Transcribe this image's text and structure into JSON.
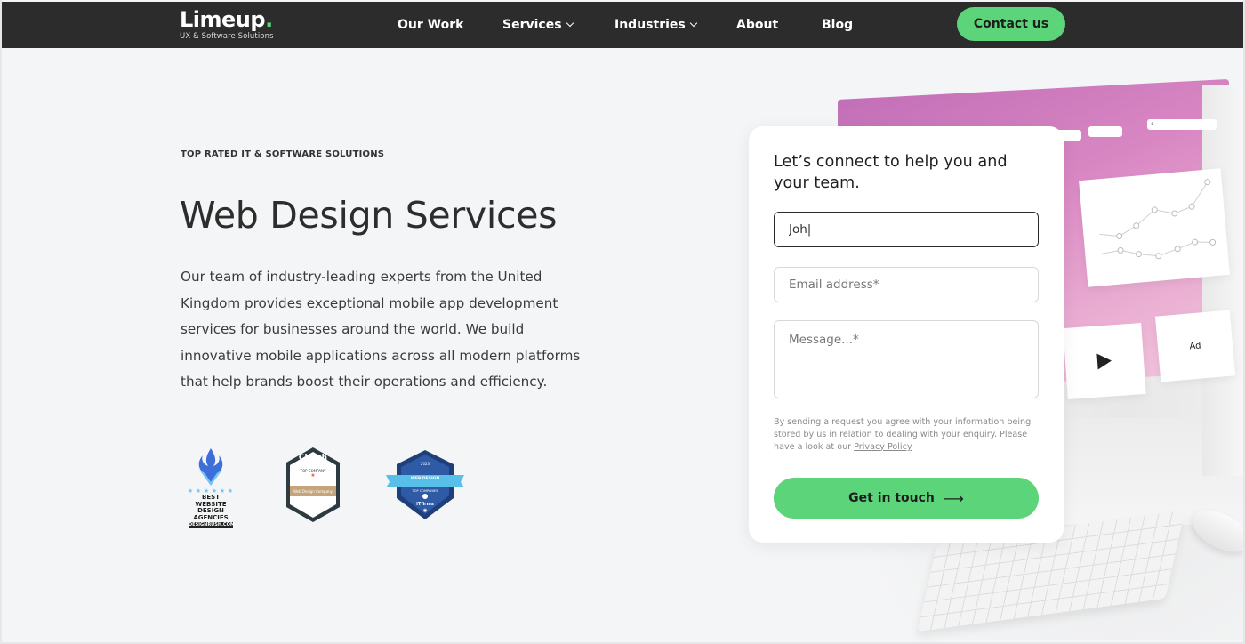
{
  "nav": {
    "logo": {
      "word": "Limeup",
      "dot": ".",
      "tagline": "UX & Software Solutions"
    },
    "links": [
      {
        "label": "Our Work"
      },
      {
        "label": "Services"
      },
      {
        "label": "Industries"
      },
      {
        "label": "About"
      },
      {
        "label": "Blog"
      }
    ],
    "cta_label": "Contact us"
  },
  "hero": {
    "eyebrow": "TOP RATED IT & SOFTWARE SOLUTIONS",
    "title": "Web Design Services",
    "description": "Our team of industry-leading experts from the United Kingdom provides exceptional mobile app development services for businesses around the world. We build innovative mobile applications across all modern platforms that help brands boost their operations and efficiency."
  },
  "badges": {
    "designrush": {
      "line1": "BEST",
      "line2": "WEBSITE DESIGN",
      "line3": "AGENCIES",
      "line4": "DESIGNRUSH.COM"
    },
    "clutch": {
      "brand": "Clutch",
      "top": "TOP COMPANY",
      "category": "Web Design Company"
    },
    "itfirms": {
      "year": "2023",
      "ribbon": "WEB DESIGN",
      "sub": "TOP COMPANIES",
      "brand": "ITfirms"
    }
  },
  "illustration": {
    "ad_label": "Ad"
  },
  "form": {
    "title": "Let’s connect to help you and your team.",
    "name_value": "Joh|",
    "email_placeholder": "Email address*",
    "message_placeholder": "Message...*",
    "consent_text": "By sending a request you agree with your information being stored by us in relation to dealing with your enquiry. Please have a look at our ",
    "privacy_link": "Privacy Policy",
    "submit_label": "Get in touch",
    "submit_arrow": "⟶"
  },
  "colors": {
    "nav_bg": "#2c2c2c",
    "accent": "#5cd47a",
    "page_bg": "#f4f5f6"
  }
}
